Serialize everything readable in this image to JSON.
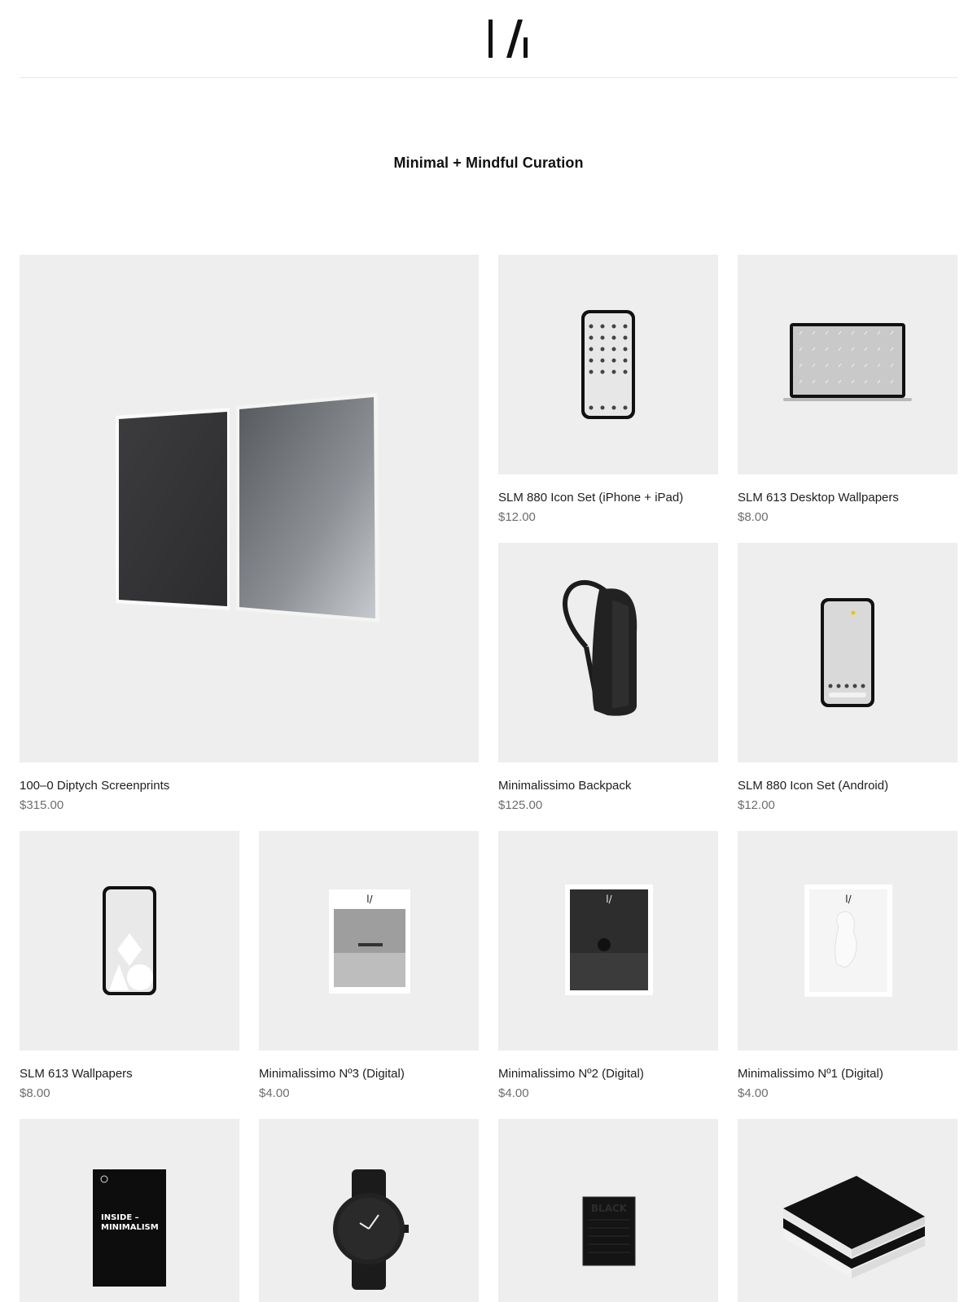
{
  "brand": {
    "logo_label": "logo"
  },
  "tagline": "Minimal + Mindful Curation",
  "products": [
    {
      "title": "100–0 Diptych Screenprints",
      "price": "$315.00",
      "image": "diptych-screenprints"
    },
    {
      "title": "SLM 880 Icon Set (iPhone + iPad)",
      "price": "$12.00",
      "image": "iphone-icon-set"
    },
    {
      "title": "SLM 613 Desktop Wallpapers",
      "price": "$8.00",
      "image": "laptop-wallpapers"
    },
    {
      "title": "Minimalissimo Backpack",
      "price": "$125.00",
      "image": "backpack"
    },
    {
      "title": "SLM 880 Icon Set (Android)",
      "price": "$12.00",
      "image": "android-phone"
    },
    {
      "title": "SLM 613 Wallpapers",
      "price": "$8.00",
      "image": "phone-wallpaper"
    },
    {
      "title": "Minimalissimo Nº3 (Digital)",
      "price": "$4.00",
      "image": "magazine-no3"
    },
    {
      "title": "Minimalissimo Nº2 (Digital)",
      "price": "$4.00",
      "image": "magazine-no2"
    },
    {
      "title": "Minimalissimo Nº1 (Digital)",
      "price": "$4.00",
      "image": "magazine-no1"
    },
    {
      "title": "",
      "price": "",
      "image": "inside-minimalism-book"
    },
    {
      "title": "",
      "price": "",
      "image": "black-watch"
    },
    {
      "title": "",
      "price": "",
      "image": "black-book"
    },
    {
      "title": "",
      "price": "",
      "image": "book-stack"
    }
  ],
  "book_cover": {
    "line1": "INSIDE –",
    "line2": "MINIMALISM"
  },
  "black_book_title": "BLACK",
  "colors": {
    "placeholder_bg": "#eeeeee",
    "price": "#6e6e6e",
    "divider": "#e6e6e6"
  }
}
